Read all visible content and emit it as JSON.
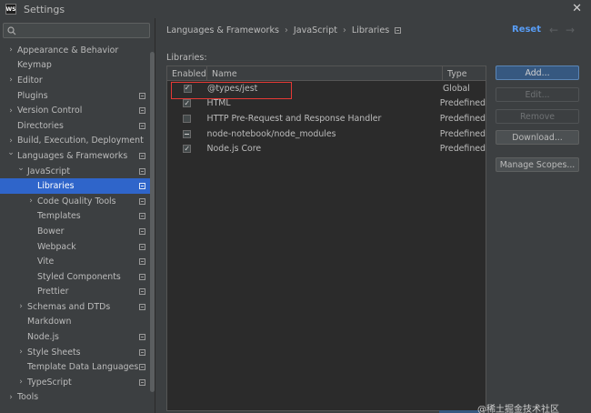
{
  "window": {
    "app_icon_text": "WS",
    "title": "Settings",
    "close_glyph": "✕"
  },
  "sidebar": {
    "search": {
      "placeholder": "",
      "value": "",
      "icon": "search-icon"
    },
    "items": [
      {
        "label": "Appearance & Behavior",
        "indent": 0,
        "arrow": "right",
        "proj": false,
        "selected": false
      },
      {
        "label": "Keymap",
        "indent": 0,
        "arrow": "",
        "proj": false,
        "selected": false
      },
      {
        "label": "Editor",
        "indent": 0,
        "arrow": "right",
        "proj": false,
        "selected": false
      },
      {
        "label": "Plugins",
        "indent": 0,
        "arrow": "",
        "proj": true,
        "selected": false
      },
      {
        "label": "Version Control",
        "indent": 0,
        "arrow": "right",
        "proj": true,
        "selected": false
      },
      {
        "label": "Directories",
        "indent": 0,
        "arrow": "",
        "proj": true,
        "selected": false
      },
      {
        "label": "Build, Execution, Deployment",
        "indent": 0,
        "arrow": "right",
        "proj": false,
        "selected": false
      },
      {
        "label": "Languages & Frameworks",
        "indent": 0,
        "arrow": "down",
        "proj": true,
        "selected": false
      },
      {
        "label": "JavaScript",
        "indent": 1,
        "arrow": "down",
        "proj": true,
        "selected": false
      },
      {
        "label": "Libraries",
        "indent": 2,
        "arrow": "",
        "proj": true,
        "selected": true
      },
      {
        "label": "Code Quality Tools",
        "indent": 2,
        "arrow": "right",
        "proj": true,
        "selected": false
      },
      {
        "label": "Templates",
        "indent": 2,
        "arrow": "",
        "proj": true,
        "selected": false
      },
      {
        "label": "Bower",
        "indent": 2,
        "arrow": "",
        "proj": true,
        "selected": false
      },
      {
        "label": "Webpack",
        "indent": 2,
        "arrow": "",
        "proj": true,
        "selected": false
      },
      {
        "label": "Vite",
        "indent": 2,
        "arrow": "",
        "proj": true,
        "selected": false
      },
      {
        "label": "Styled Components",
        "indent": 2,
        "arrow": "",
        "proj": true,
        "selected": false
      },
      {
        "label": "Prettier",
        "indent": 2,
        "arrow": "",
        "proj": true,
        "selected": false
      },
      {
        "label": "Schemas and DTDs",
        "indent": 1,
        "arrow": "right",
        "proj": true,
        "selected": false
      },
      {
        "label": "Markdown",
        "indent": 1,
        "arrow": "",
        "proj": false,
        "selected": false
      },
      {
        "label": "Node.js",
        "indent": 1,
        "arrow": "",
        "proj": true,
        "selected": false
      },
      {
        "label": "Style Sheets",
        "indent": 1,
        "arrow": "right",
        "proj": true,
        "selected": false
      },
      {
        "label": "Template Data Languages",
        "indent": 1,
        "arrow": "",
        "proj": true,
        "selected": false
      },
      {
        "label": "TypeScript",
        "indent": 1,
        "arrow": "right",
        "proj": true,
        "selected": false
      },
      {
        "label": "Tools",
        "indent": 0,
        "arrow": "right",
        "proj": false,
        "selected": false
      }
    ]
  },
  "main": {
    "breadcrumb": [
      "Languages & Frameworks",
      "JavaScript",
      "Libraries"
    ],
    "breadcrumb_sep": "›",
    "reset_label": "Reset",
    "back_glyph": "←",
    "forward_glyph": "→",
    "libraries_label": "Libraries:",
    "table": {
      "headers": {
        "enabled": "Enabled",
        "name": "Name",
        "type": "Type"
      },
      "rows": [
        {
          "checked": true,
          "indeterminate": false,
          "name": "@types/jest",
          "type": "Global"
        },
        {
          "checked": true,
          "indeterminate": false,
          "name": "HTML",
          "type": "Predefined"
        },
        {
          "checked": false,
          "indeterminate": false,
          "name": "HTTP Pre-Request and Response Handler",
          "type": "Predefined"
        },
        {
          "checked": false,
          "indeterminate": true,
          "name": "node-notebook/node_modules",
          "type": "Predefined"
        },
        {
          "checked": true,
          "indeterminate": false,
          "name": "Node.js Core",
          "type": "Predefined"
        }
      ]
    },
    "buttons": {
      "add": "Add...",
      "edit": "Edit...",
      "remove": "Remove",
      "download": "Download...",
      "manage_scopes": "Manage Scopes..."
    }
  },
  "watermark": "@稀土掘金技术社区",
  "colors": {
    "background": "#3c3f41",
    "selection": "#2f65ca",
    "link": "#589df6",
    "highlight_border": "#e53935"
  }
}
